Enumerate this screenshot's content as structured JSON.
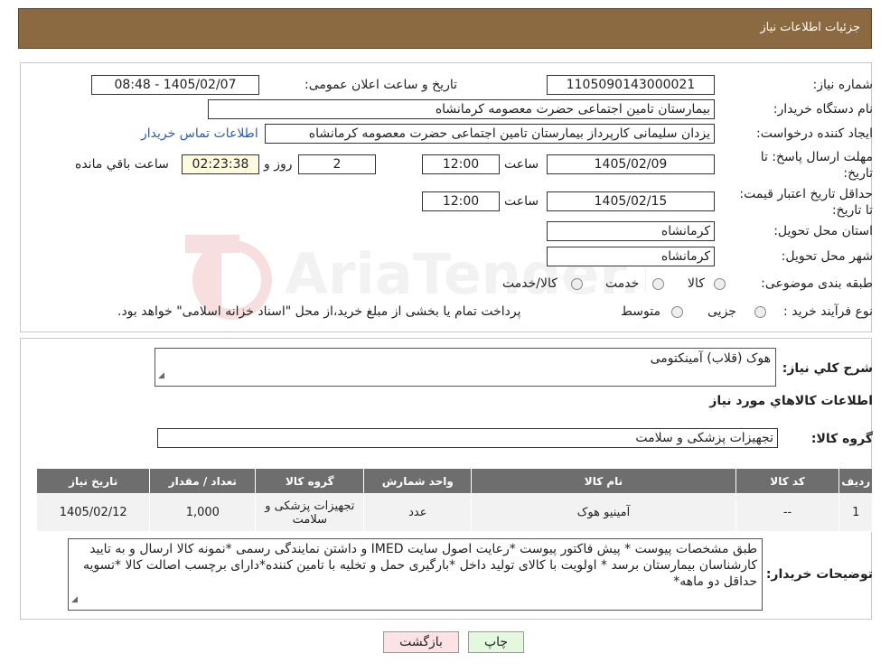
{
  "header": {
    "title": "جزئیات اطلاعات نیاز"
  },
  "form": {
    "need_number_label": "شماره نیاز:",
    "need_number": "1105090143000021",
    "announce_label": "تاریخ و ساعت اعلان عمومی:",
    "announce_value": "1405/02/07 - 08:48",
    "buyer_org_label": "نام دستگاه خریدار:",
    "buyer_org": "بیمارستان تامین اجتماعی حضرت معصومه کرمانشاه",
    "creator_label": "ایجاد کننده درخواست:",
    "creator": "یزدان  سلیمانی کارپرداز بیمارستان تامین اجتماعی حضرت معصومه کرمانشاه",
    "contact_link": "اطلاعات تماس خریدار",
    "deadline_label": "مهلت ارسال پاسخ: تا تاریخ:",
    "deadline_date": "1405/02/09",
    "time_label": "ساعت",
    "deadline_time": "12:00",
    "days_value": "2",
    "days_label": "روز و",
    "remaining_value": "02:23:38",
    "remaining_label": "ساعت باقي مانده",
    "validity_label": "حداقل تاریخ اعتبار قیمت: تا تاریخ:",
    "validity_date": "1405/02/15",
    "validity_time": "12:00",
    "province_label": "استان محل تحویل:",
    "province": "کرمانشاه",
    "city_label": "شهر محل تحویل:",
    "city": "کرمانشاه",
    "category_label": "طبقه بندی موضوعی:",
    "category_options": [
      "کالا",
      "خدمت",
      "کالا/خدمت"
    ],
    "process_label": "نوع فرآیند خرید :",
    "process_options": [
      "جزیی",
      "متوسط"
    ],
    "process_note": "پرداخت تمام یا بخشی از مبلغ خرید،از محل \"اسناد خزانه اسلامی\" خواهد بود."
  },
  "watermark": {
    "text": "AriaTender.neT"
  },
  "details": {
    "summary_label": "شرح کلي نياز:",
    "summary_value": "هوک (قلاب) آمینکتومی",
    "goods_title": "اطلاعات کالاهاي مورد نياز",
    "group_label": "گروه کالا:",
    "group_value": "تجهیزات پزشکی و سلامت",
    "table": {
      "headers": [
        "رديف",
        "کد کالا",
        "نام کالا",
        "واحد شمارش",
        "گروه کالا",
        "تعداد / مقدار",
        "تاريخ نياز"
      ],
      "rows": [
        [
          "1",
          "--",
          "آمینیو هوک",
          "عدد",
          "تجهیزات پزشکی و سلامت",
          "1,000",
          "1405/02/12"
        ]
      ]
    },
    "buyer_notes_label": "توضیحات خریدار:",
    "buyer_notes": "طبق مشخصات پیوست * پیش فاکتور پیوست *رعایت اصول سایت IMED و داشتن نمایندگی رسمی *نمونه کالا ارسال و به تایید کارشناسان بیمارستان برسد * اولویت با کالای تولید داخل  *بارگیری حمل و تخلیه با تامین کننده*دارای برچسب اصالت کالا *تسویه حداقل دو ماهه*"
  },
  "buttons": {
    "print": "چاپ",
    "back": "بازگشت"
  }
}
